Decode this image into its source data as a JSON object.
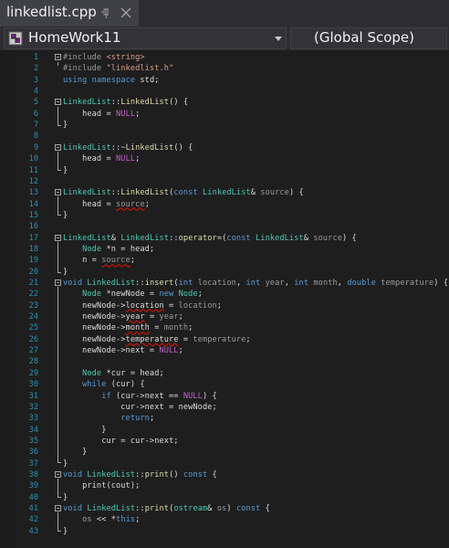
{
  "tab": {
    "title": "linkedlist.cpp"
  },
  "navbar": {
    "project": "HomeWork11",
    "scope": "(Global Scope)"
  },
  "colors": {
    "keyword": "#569cd6",
    "type": "#4ec9b0",
    "string": "#d69d85",
    "preprocessor": "#9b9b9b",
    "macro": "#bd63c5",
    "line_number": "#2b91af",
    "text": "#dcdcdc",
    "background": "#1e1e1e"
  },
  "code_lines": [
    {
      "n": "1",
      "tokens": [
        {
          "t": "#include ",
          "c": "pp"
        },
        {
          "t": "<string>",
          "c": "str"
        }
      ]
    },
    {
      "n": "2",
      "tokens": [
        {
          "t": "#include ",
          "c": "pp"
        },
        {
          "t": "\"linkedlist.h\"",
          "c": "str"
        }
      ]
    },
    {
      "n": "3",
      "tokens": [
        {
          "t": "using ",
          "c": "kw"
        },
        {
          "t": "namespace ",
          "c": "kw"
        },
        {
          "t": "std;",
          "c": ""
        }
      ]
    },
    {
      "n": "4",
      "tokens": []
    },
    {
      "n": "5",
      "tokens": [
        {
          "t": "LinkedList",
          "c": "type"
        },
        {
          "t": "::",
          "c": ""
        },
        {
          "t": "LinkedList",
          "c": "fn"
        },
        {
          "t": "() {",
          "c": ""
        }
      ]
    },
    {
      "n": "6",
      "tokens": [
        {
          "t": "    head",
          "c": "member"
        },
        {
          "t": " = ",
          "c": ""
        },
        {
          "t": "NULL",
          "c": "macro"
        },
        {
          "t": ";",
          "c": ""
        }
      ]
    },
    {
      "n": "7",
      "tokens": [
        {
          "t": "}",
          "c": ""
        }
      ]
    },
    {
      "n": "8",
      "tokens": []
    },
    {
      "n": "9",
      "tokens": [
        {
          "t": "LinkedList",
          "c": "type"
        },
        {
          "t": "::",
          "c": ""
        },
        {
          "t": "~LinkedList",
          "c": "fn"
        },
        {
          "t": "() {",
          "c": ""
        }
      ]
    },
    {
      "n": "10",
      "tokens": [
        {
          "t": "    head",
          "c": "member"
        },
        {
          "t": " = ",
          "c": ""
        },
        {
          "t": "NULL",
          "c": "macro"
        },
        {
          "t": ";",
          "c": ""
        }
      ]
    },
    {
      "n": "11",
      "tokens": [
        {
          "t": "}",
          "c": ""
        }
      ]
    },
    {
      "n": "12",
      "tokens": []
    },
    {
      "n": "13",
      "tokens": [
        {
          "t": "LinkedList",
          "c": "type"
        },
        {
          "t": "::",
          "c": ""
        },
        {
          "t": "LinkedList",
          "c": "fn"
        },
        {
          "t": "(",
          "c": ""
        },
        {
          "t": "const ",
          "c": "kw"
        },
        {
          "t": "LinkedList",
          "c": "type"
        },
        {
          "t": "& ",
          "c": ""
        },
        {
          "t": "source",
          "c": "param"
        },
        {
          "t": ") {",
          "c": ""
        }
      ]
    },
    {
      "n": "14",
      "tokens": [
        {
          "t": "    head",
          "c": "member"
        },
        {
          "t": " = ",
          "c": ""
        },
        {
          "t": "source",
          "c": "param squig"
        },
        {
          "t": ";",
          "c": ""
        }
      ]
    },
    {
      "n": "15",
      "tokens": [
        {
          "t": "}",
          "c": ""
        }
      ]
    },
    {
      "n": "16",
      "tokens": []
    },
    {
      "n": "17",
      "tokens": [
        {
          "t": "LinkedList",
          "c": "type"
        },
        {
          "t": "& ",
          "c": ""
        },
        {
          "t": "LinkedList",
          "c": "type"
        },
        {
          "t": "::",
          "c": ""
        },
        {
          "t": "operator=",
          "c": "fn"
        },
        {
          "t": "(",
          "c": ""
        },
        {
          "t": "const ",
          "c": "kw"
        },
        {
          "t": "LinkedList",
          "c": "type"
        },
        {
          "t": "& ",
          "c": ""
        },
        {
          "t": "source",
          "c": "param"
        },
        {
          "t": ") {",
          "c": ""
        }
      ]
    },
    {
      "n": "18",
      "tokens": [
        {
          "t": "    Node ",
          "c": "type"
        },
        {
          "t": "*n = head;",
          "c": ""
        }
      ]
    },
    {
      "n": "19",
      "tokens": [
        {
          "t": "    n = ",
          "c": ""
        },
        {
          "t": "source",
          "c": "param squig"
        },
        {
          "t": ";",
          "c": ""
        }
      ]
    },
    {
      "n": "20",
      "tokens": [
        {
          "t": "}",
          "c": ""
        }
      ]
    },
    {
      "n": "21",
      "tokens": [
        {
          "t": "void ",
          "c": "kw"
        },
        {
          "t": "LinkedList",
          "c": "type"
        },
        {
          "t": "::",
          "c": ""
        },
        {
          "t": "insert",
          "c": "fn"
        },
        {
          "t": "(",
          "c": ""
        },
        {
          "t": "int ",
          "c": "kw"
        },
        {
          "t": "location",
          "c": "param"
        },
        {
          "t": ", ",
          "c": ""
        },
        {
          "t": "int ",
          "c": "kw"
        },
        {
          "t": "year",
          "c": "param"
        },
        {
          "t": ", ",
          "c": ""
        },
        {
          "t": "int ",
          "c": "kw"
        },
        {
          "t": "month",
          "c": "param"
        },
        {
          "t": ", ",
          "c": ""
        },
        {
          "t": "double ",
          "c": "kw"
        },
        {
          "t": "temperature",
          "c": "param"
        },
        {
          "t": ") {",
          "c": ""
        }
      ]
    },
    {
      "n": "22",
      "tokens": [
        {
          "t": "    Node ",
          "c": "type"
        },
        {
          "t": "*newNode = ",
          "c": ""
        },
        {
          "t": "new ",
          "c": "kw"
        },
        {
          "t": "Node",
          "c": "type"
        },
        {
          "t": ";",
          "c": ""
        }
      ]
    },
    {
      "n": "23",
      "tokens": [
        {
          "t": "    newNode->",
          "c": ""
        },
        {
          "t": "location",
          "c": "squig"
        },
        {
          "t": " = ",
          "c": ""
        },
        {
          "t": "location",
          "c": "param"
        },
        {
          "t": ";",
          "c": ""
        }
      ]
    },
    {
      "n": "24",
      "tokens": [
        {
          "t": "    newNode->",
          "c": ""
        },
        {
          "t": "year",
          "c": "squig"
        },
        {
          "t": " = ",
          "c": ""
        },
        {
          "t": "year",
          "c": "param"
        },
        {
          "t": ";",
          "c": ""
        }
      ]
    },
    {
      "n": "25",
      "tokens": [
        {
          "t": "    newNode->",
          "c": ""
        },
        {
          "t": "month",
          "c": "squig"
        },
        {
          "t": " = ",
          "c": ""
        },
        {
          "t": "month",
          "c": "param"
        },
        {
          "t": ";",
          "c": ""
        }
      ]
    },
    {
      "n": "26",
      "tokens": [
        {
          "t": "    newNode->",
          "c": ""
        },
        {
          "t": "temperature",
          "c": "squig"
        },
        {
          "t": " = ",
          "c": ""
        },
        {
          "t": "temperature",
          "c": "param"
        },
        {
          "t": ";",
          "c": ""
        }
      ]
    },
    {
      "n": "27",
      "tokens": [
        {
          "t": "    newNode->next = ",
          "c": ""
        },
        {
          "t": "NULL",
          "c": "macro"
        },
        {
          "t": ";",
          "c": ""
        }
      ]
    },
    {
      "n": "28",
      "tokens": []
    },
    {
      "n": "29",
      "tokens": [
        {
          "t": "    Node ",
          "c": "type"
        },
        {
          "t": "*cur = head;",
          "c": ""
        }
      ]
    },
    {
      "n": "30",
      "tokens": [
        {
          "t": "    while ",
          "c": "kw"
        },
        {
          "t": "(cur) {",
          "c": ""
        }
      ]
    },
    {
      "n": "31",
      "tokens": [
        {
          "t": "        if ",
          "c": "kw"
        },
        {
          "t": "(cur->next == ",
          "c": ""
        },
        {
          "t": "NULL",
          "c": "macro"
        },
        {
          "t": ") {",
          "c": ""
        }
      ]
    },
    {
      "n": "32",
      "tokens": [
        {
          "t": "            cur->next = newNode;",
          "c": ""
        }
      ]
    },
    {
      "n": "33",
      "tokens": [
        {
          "t": "            return",
          "c": "kw"
        },
        {
          "t": ";",
          "c": ""
        }
      ]
    },
    {
      "n": "34",
      "tokens": [
        {
          "t": "        }",
          "c": ""
        }
      ]
    },
    {
      "n": "35",
      "tokens": [
        {
          "t": "        cur = cur->next;",
          "c": ""
        }
      ]
    },
    {
      "n": "36",
      "tokens": [
        {
          "t": "    }",
          "c": ""
        }
      ]
    },
    {
      "n": "37",
      "tokens": [
        {
          "t": "}",
          "c": ""
        }
      ]
    },
    {
      "n": "38",
      "tokens": [
        {
          "t": "void ",
          "c": "kw"
        },
        {
          "t": "LinkedList",
          "c": "type"
        },
        {
          "t": "::",
          "c": ""
        },
        {
          "t": "print",
          "c": "fn"
        },
        {
          "t": "() ",
          "c": ""
        },
        {
          "t": "const ",
          "c": "kw"
        },
        {
          "t": "{",
          "c": ""
        }
      ]
    },
    {
      "n": "39",
      "tokens": [
        {
          "t": "    print(cout);",
          "c": ""
        }
      ]
    },
    {
      "n": "40",
      "tokens": [
        {
          "t": "}",
          "c": ""
        }
      ]
    },
    {
      "n": "41",
      "tokens": [
        {
          "t": "void ",
          "c": "kw"
        },
        {
          "t": "LinkedList",
          "c": "type"
        },
        {
          "t": "::",
          "c": ""
        },
        {
          "t": "print",
          "c": "fn"
        },
        {
          "t": "(",
          "c": ""
        },
        {
          "t": "ostream",
          "c": "type"
        },
        {
          "t": "& ",
          "c": ""
        },
        {
          "t": "os",
          "c": "param"
        },
        {
          "t": ") ",
          "c": ""
        },
        {
          "t": "const ",
          "c": "kw"
        },
        {
          "t": "{",
          "c": ""
        }
      ]
    },
    {
      "n": "42",
      "tokens": [
        {
          "t": "    ",
          "c": ""
        },
        {
          "t": "os",
          "c": "param"
        },
        {
          "t": " << *",
          "c": ""
        },
        {
          "t": "this",
          "c": "kw"
        },
        {
          "t": ";",
          "c": ""
        }
      ]
    },
    {
      "n": "43",
      "tokens": [
        {
          "t": "}",
          "c": ""
        }
      ]
    }
  ]
}
